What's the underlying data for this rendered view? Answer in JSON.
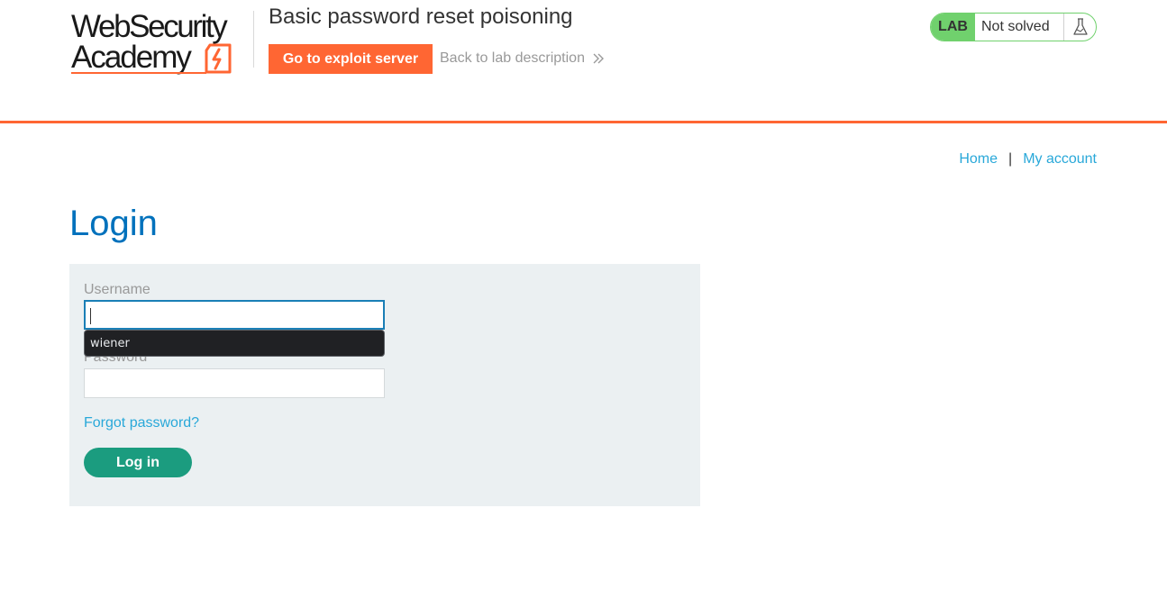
{
  "header": {
    "logo": {
      "line1": "WebSecurity",
      "line2": "Academy",
      "icon": "lightning-bolt-icon"
    },
    "lab_title": "Basic password reset poisoning",
    "exploit_button_label": "Go to exploit server",
    "back_link_label": "Back to lab description",
    "back_link_icon": "double-chevron-right-icon",
    "lab_status": {
      "tag": "LAB",
      "state": "Not solved",
      "icon": "flask-icon"
    }
  },
  "nav": {
    "home_label": "Home",
    "separator": "|",
    "account_label": "My account"
  },
  "main": {
    "title": "Login",
    "form": {
      "username_label": "Username",
      "username_value": "",
      "autofill_suggestion": "wiener",
      "password_label": "Password",
      "password_value": "",
      "forgot_label": "Forgot password?",
      "submit_label": "Log in"
    }
  },
  "colors": {
    "accent": "#ff6633",
    "link": "#29a8d9",
    "title": "#0071bc",
    "panel": "#ebf0f2",
    "submit": "#1b9c7f",
    "lab_green": "#70d16d"
  }
}
